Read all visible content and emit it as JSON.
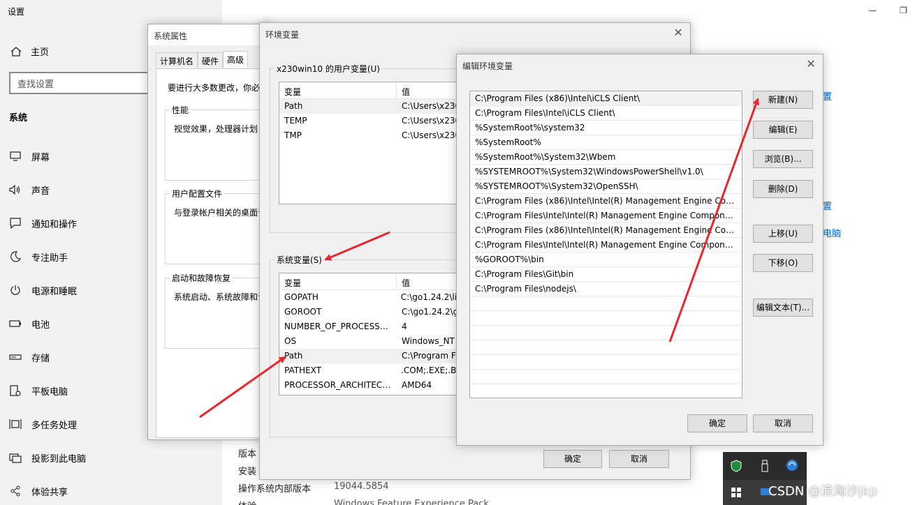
{
  "settings": {
    "title": "设置",
    "home": "主页",
    "search_placeholder": "查找设置",
    "section": "系统",
    "nav": [
      {
        "label": "屏幕",
        "icon": "monitor-icon"
      },
      {
        "label": "声音",
        "icon": "speaker-icon"
      },
      {
        "label": "通知和操作",
        "icon": "notification-icon"
      },
      {
        "label": "专注助手",
        "icon": "moon-icon"
      },
      {
        "label": "电源和睡眠",
        "icon": "power-icon"
      },
      {
        "label": "电池",
        "icon": "battery-icon"
      },
      {
        "label": "存储",
        "icon": "storage-icon"
      },
      {
        "label": "平板电脑",
        "icon": "tablet-icon"
      },
      {
        "label": "多任务处理",
        "icon": "multitask-icon"
      },
      {
        "label": "投影到此电脑",
        "icon": "project-icon"
      },
      {
        "label": "体验共享",
        "icon": "share-icon"
      }
    ],
    "right_links": [
      "置",
      "置",
      "电脑"
    ],
    "about": [
      {
        "label": "版本",
        "value": ""
      },
      {
        "label": "安装",
        "value": ""
      },
      {
        "label": "操作系统内部版本",
        "value": "19044.5854"
      },
      {
        "label": "体验",
        "value": "Windows Feature Experience Pack"
      }
    ]
  },
  "system_properties": {
    "title": "系统属性",
    "tabs": [
      "计算机名",
      "硬件",
      "高级"
    ],
    "note": "要进行大多数更改，你必",
    "groups": [
      {
        "legend": "性能",
        "desc": "视觉效果，处理器计划，"
      },
      {
        "legend": "用户配置文件",
        "desc": "与登录帐户相关的桌面设"
      },
      {
        "legend": "启动和故障恢复",
        "desc": "系统启动、系统故障和调"
      }
    ]
  },
  "env_vars": {
    "title": "环境变量",
    "user_group": "x230win10 的用户变量(U)",
    "col_var": "变量",
    "col_val": "值",
    "user_rows": [
      {
        "name": "Path",
        "value": "C:\\Users\\x230"
      },
      {
        "name": "TEMP",
        "value": "C:\\Users\\x230"
      },
      {
        "name": "TMP",
        "value": "C:\\Users\\x230"
      }
    ],
    "sys_group": "系统变量(S)",
    "sys_rows": [
      {
        "name": "GOPATH",
        "value": "C:\\go1.24.2\\lib"
      },
      {
        "name": "GOROOT",
        "value": "C:\\go1.24.2\\g"
      },
      {
        "name": "NUMBER_OF_PROCESSORS",
        "value": "4"
      },
      {
        "name": "OS",
        "value": "Windows_NT"
      },
      {
        "name": "Path",
        "value": "C:\\Program Fi"
      },
      {
        "name": "PATHEXT",
        "value": ".COM;.EXE;.BA"
      },
      {
        "name": "PROCESSOR_ARCHITECT...",
        "value": "AMD64"
      }
    ],
    "ok": "确定",
    "cancel": "取消"
  },
  "edit_env": {
    "title": "编辑环境变量",
    "paths": [
      "C:\\Program Files (x86)\\Intel\\iCLS Client\\",
      "C:\\Program Files\\Intel\\iCLS Client\\",
      "%SystemRoot%\\system32",
      "%SystemRoot%",
      "%SystemRoot%\\System32\\Wbem",
      "%SYSTEMROOT%\\System32\\WindowsPowerShell\\v1.0\\",
      "%SYSTEMROOT%\\System32\\OpenSSH\\",
      "C:\\Program Files (x86)\\Intel\\Intel(R) Management Engine Comp...",
      "C:\\Program Files\\Intel\\Intel(R) Management Engine Component...",
      "C:\\Program Files (x86)\\Intel\\Intel(R) Management Engine Comp...",
      "C:\\Program Files\\Intel\\Intel(R) Management Engine Component...",
      "%GOROOT%\\bin",
      "C:\\Program Files\\Git\\bin",
      "C:\\Program Files\\nodejs\\"
    ],
    "buttons": {
      "new": "新建(N)",
      "edit": "编辑(E)",
      "browse": "浏览(B)...",
      "delete": "删除(D)",
      "up": "上移(U)",
      "down": "下移(O)",
      "edit_text": "编辑文本(T)..."
    },
    "ok": "确定",
    "cancel": "取消"
  },
  "watermark": "CSDN @浪淘沙jkp",
  "colors": {
    "arrow": "#e8262b",
    "link": "#0066cc"
  }
}
